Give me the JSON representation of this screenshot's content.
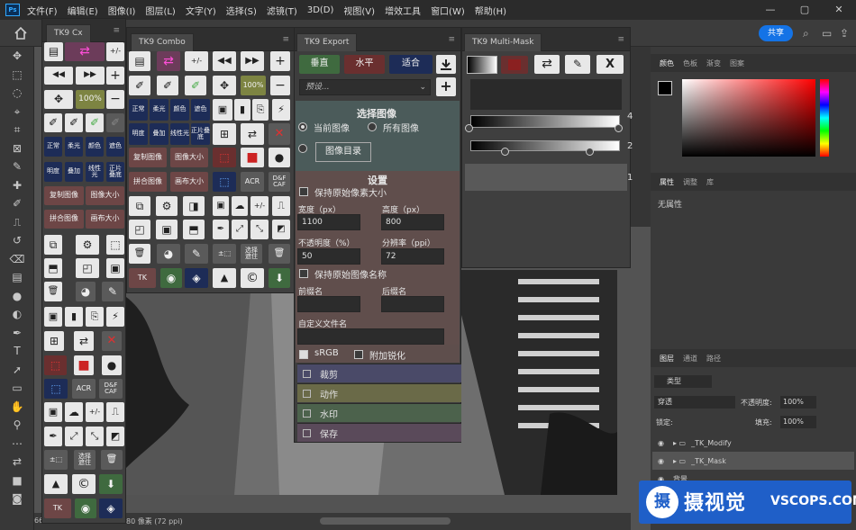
{
  "menubar": {
    "items": [
      "文件(F)",
      "编辑(E)",
      "图像(I)",
      "图层(L)",
      "文字(Y)",
      "选择(S)",
      "滤镜(T)",
      "3D(D)",
      "视图(V)",
      "增效工具",
      "窗口(W)",
      "帮助(H)"
    ],
    "logo": "Ps"
  },
  "window_controls": [
    "—",
    "▢",
    "✕"
  ],
  "options": {
    "share": "共享"
  },
  "tk9cx": {
    "tab": "TK9 Cx",
    "labels": {
      "b100": "100%",
      "zhengchang": "正常",
      "rouguang": "柔光",
      "yanse": "颜色",
      "zhese": "遮色",
      "mingdu": "明度",
      "dieja": "叠加",
      "lianxing": "线性光",
      "zhengpian": "正片叠底",
      "fuzhi": "复制图像",
      "huamian": "图像大小",
      "pinhe": "拼合图像",
      "buda": "画布大小",
      "acr": "ACR",
      "dcaf": "D&F\nCAF",
      "xuanze": "选择\n遮住",
      "tk": "TK"
    }
  },
  "tk9combo": {
    "tab": "TK9 Combo",
    "labels": {
      "b100": "100%",
      "zhengchang": "正常",
      "rouguang": "柔光",
      "yanse": "颜色",
      "zhese": "遮色",
      "mingdu": "明度",
      "dieja": "叠加",
      "lianxing": "线性光",
      "zhengpian": "正片叠底",
      "fuzhi": "复制图像",
      "huamian": "图像大小",
      "pinhe": "拼合图像",
      "buda": "画布大小",
      "acr": "ACR",
      "dcaf": "D&F\nCAF",
      "xuanze": "选择\n遮住",
      "tk": "TK"
    }
  },
  "tk9export": {
    "tab": "TK9 Export",
    "top_buttons": [
      "垂直",
      "水平",
      "适合"
    ],
    "preset_placeholder": "预设...",
    "select_heading": "选择图像",
    "radio_current": "当前图像",
    "radio_all": "所有图像",
    "dir_button": "图像目录",
    "settings_heading": "设置",
    "keep_pixel": "保持原始像素大小",
    "width_label": "宽度（px）",
    "width_value": "1100",
    "height_label": "高度（px）",
    "height_value": "800",
    "opacity_label": "不透明度（%）",
    "opacity_value": "50",
    "ppi_label": "分辨率（ppi）",
    "ppi_value": "72",
    "keep_name": "保持原始图像名称",
    "prefix_label": "前缀名",
    "suffix_label": "后缀名",
    "custom_name_label": "自定义文件名",
    "srgb": "sRGB",
    "sharpen": "附加锐化",
    "sections": [
      "裁剪",
      "动作",
      "水印",
      "保存"
    ]
  },
  "tk9mask": {
    "tab": "TK9 Multi-Mask",
    "digits": [
      "1",
      "2",
      "3",
      "4",
      "5",
      "6",
      "7",
      "8",
      "9"
    ],
    "x": "X",
    "r4": "4",
    "r2": "2",
    "r1": "1",
    "save": "Save"
  },
  "color_panel": {
    "tabs": [
      "颜色",
      "色板",
      "渐变",
      "图案"
    ]
  },
  "props_panel": {
    "tabs": [
      "属性",
      "调整",
      "库"
    ],
    "empty": "无属性"
  },
  "layers_panel": {
    "tabs": [
      "图层",
      "通道",
      "路径"
    ],
    "filter": "类型",
    "blend": "穿透",
    "opacity_label": "不透明度:",
    "opacity": "100%",
    "lock_label": "锁定:",
    "fill_label": "填充:",
    "fill": "100%",
    "layers": [
      "_TK_Modify",
      "_TK_Mask",
      "背景"
    ]
  },
  "status": {
    "left": "66",
    "text": "80 像素 (72 ppi)"
  },
  "watermark": {
    "glyph": "摄",
    "brand": "摄视觉",
    "url": "VSCOPS.COM"
  }
}
